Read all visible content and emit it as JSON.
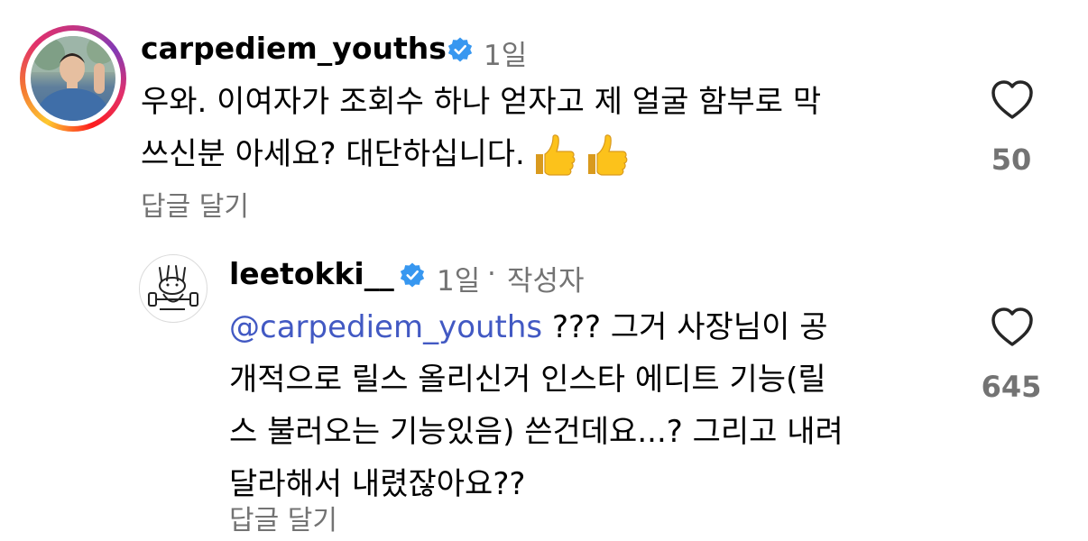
{
  "comment1": {
    "username": "carpediem_youths",
    "time": "1일",
    "text_line1": "우와. 이여자가 조회수 하나 얻자고 제 얼굴 함부로 막",
    "text_line2": "쓰신분 아세요? 대단하십니다.",
    "emoji_1": "thumbs-up",
    "emoji_2": "thumbs-up",
    "reply_label": "답글 달기",
    "like_count": "50"
  },
  "comment2": {
    "username": "leetokki__",
    "time": "1일",
    "separator": "·",
    "author_badge": "작성자",
    "mention": "@carpediem_youths",
    "text_line1_rest": " ??? 그거 사장님이 공",
    "text_line2": "개적으로 릴스 올리신거 인스타 에디트 기능(릴",
    "text_line3": "스 불러오는 기능있음) 쓴건데요...? 그리고 내려",
    "text_line4": "달라해서 내렸잖아요??",
    "reply_label": "답글 달기",
    "like_count": "645"
  },
  "colors": {
    "verified_blue": "#3797f0",
    "mention_blue": "#4259c3",
    "meta_gray": "#737373"
  },
  "icons": [
    "verified-badge-icon",
    "heart-icon",
    "thumbs-up-emoji"
  ]
}
